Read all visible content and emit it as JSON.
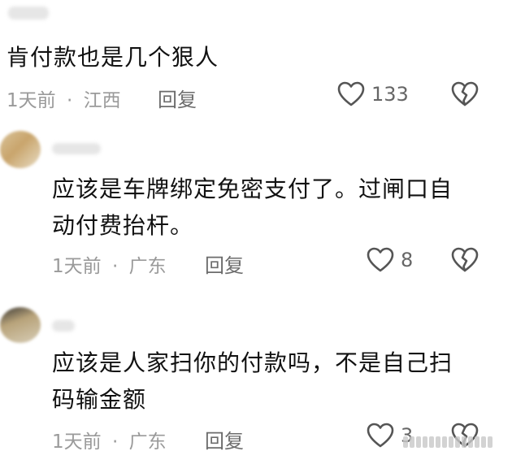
{
  "comments": [
    {
      "text_lines": [
        "肯付款也是几个狠人"
      ],
      "time": "1天前",
      "separator": "·",
      "location": "江西",
      "reply_label": "回复",
      "like_count": "133",
      "icons": {
        "like": "heart-icon",
        "dislike": "broken-heart-icon"
      }
    },
    {
      "text_lines": [
        "应该是车牌绑定免密支付了。过闸口自",
        "动付费抬杆。"
      ],
      "time": "1天前",
      "separator": "·",
      "location": "广东",
      "reply_label": "回复",
      "like_count": "8",
      "icons": {
        "like": "heart-icon",
        "dislike": "broken-heart-icon"
      }
    },
    {
      "text_lines": [
        "应该是人家扫你的付款吗，不是自己扫",
        "码输金额"
      ],
      "time": "1天前",
      "separator": "·",
      "location": "广东",
      "reply_label": "回复",
      "like_count": "3",
      "icons": {
        "like": "heart-icon",
        "dislike": "broken-heart-icon"
      }
    }
  ],
  "colors": {
    "text": "#111111",
    "meta": "#9a9a9a",
    "icon": "#555555"
  }
}
